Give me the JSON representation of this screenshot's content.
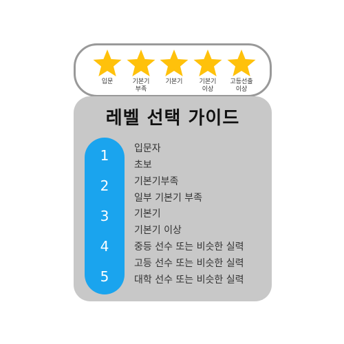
{
  "star_ratings": [
    {
      "label": "입문",
      "icon": "star-icon"
    },
    {
      "label": "기본기\n부족",
      "icon": "star-icon"
    },
    {
      "label": "기본기",
      "icon": "star-icon"
    },
    {
      "label": "기본기\n이상",
      "icon": "star-icon"
    },
    {
      "label": "고등선출\n이상",
      "icon": "star-icon"
    }
  ],
  "colors": {
    "star": "#ffc10b",
    "pill": "#1aa4ee",
    "card": "#c8c8c8",
    "border": "#999999"
  },
  "guide": {
    "title": "레벨 선택 가이드",
    "levels": [
      "1",
      "2",
      "3",
      "4",
      "5"
    ],
    "descriptions": [
      "입문자",
      "초보",
      "기본기부족",
      "일부 기본기 부족",
      "기본기",
      "기본기 이상",
      "중등 선수 또는 비슷한 실력",
      "고등 선수 또는 비슷한 실력",
      "대학 선수 또는 비슷한 실력"
    ]
  }
}
